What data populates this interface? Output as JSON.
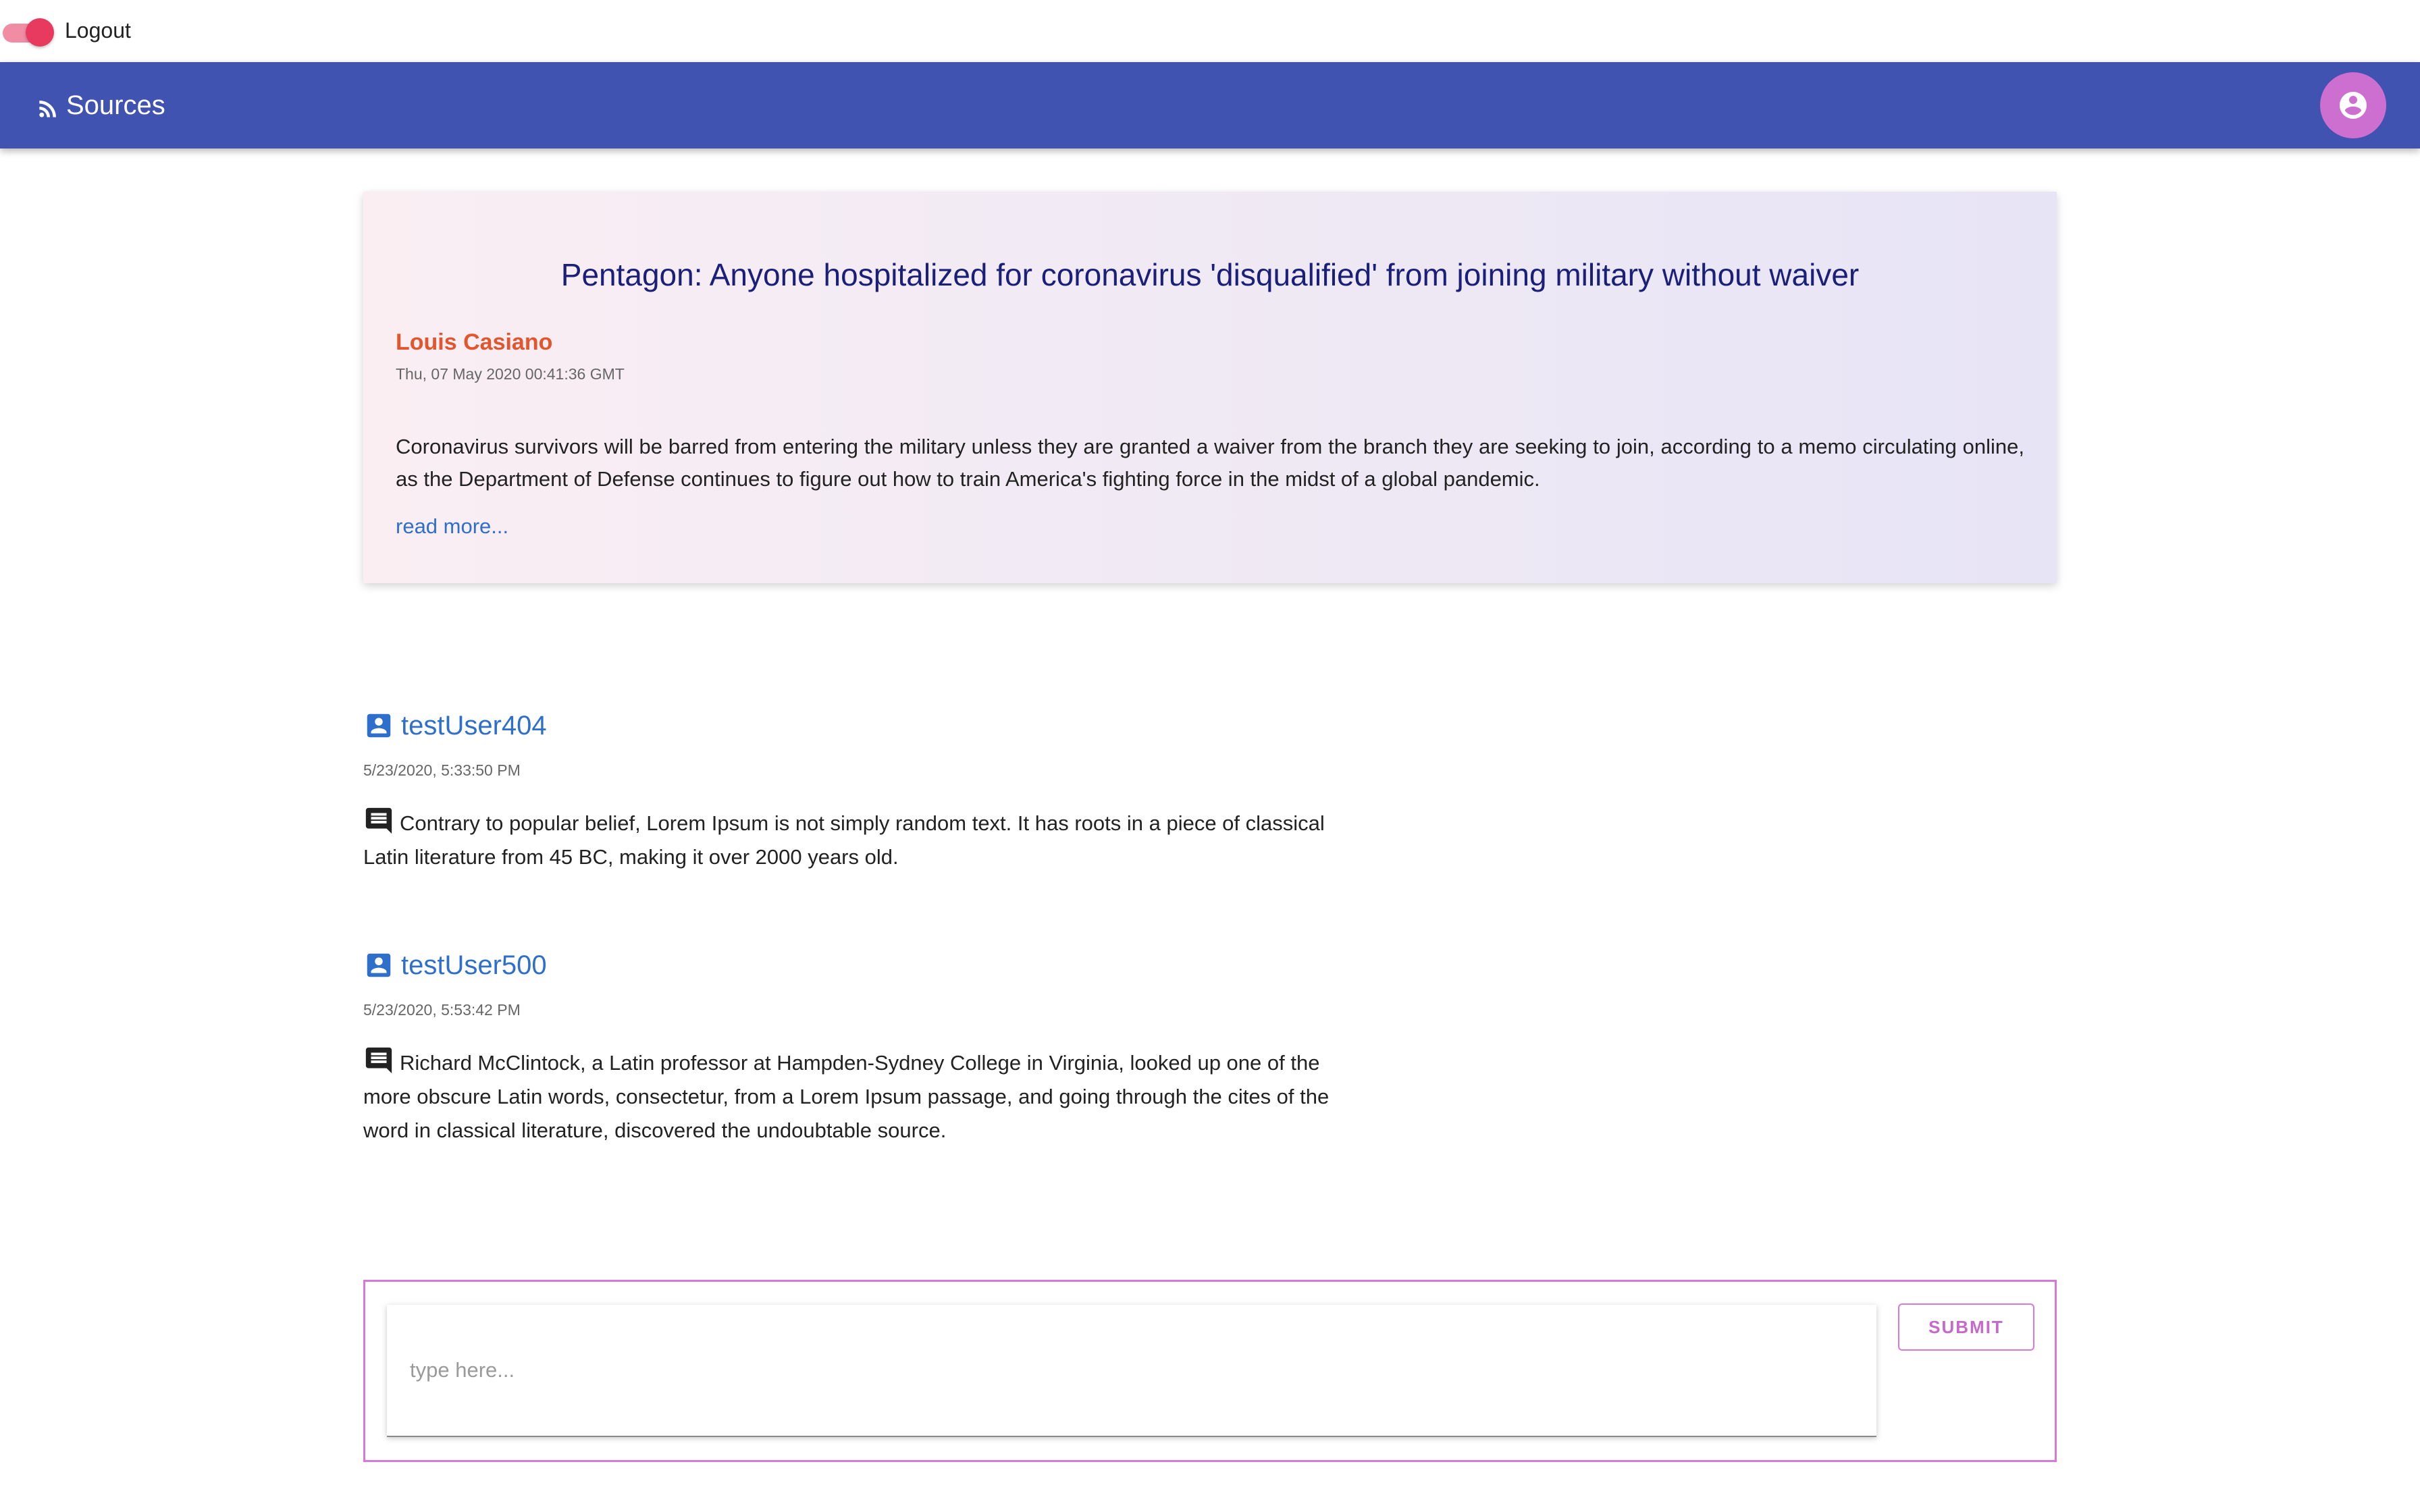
{
  "topbar": {
    "toggle_icon": "toggle-switch-icon",
    "logout_label": "Logout"
  },
  "appbar": {
    "brand_icon": "rss-feed-icon",
    "brand_label": "Sources",
    "avatar_icon": "account-circle-icon",
    "color": "#4153b1",
    "avatar_color": "#cd6fd0"
  },
  "article": {
    "title": "Pentagon: Anyone hospitalized for coronavirus 'disqualified' from joining military without waiver",
    "author": "Louis Casiano",
    "date": "Thu, 07 May 2020 00:41:36 GMT",
    "body": "Coronavirus survivors will be barred from entering the military unless they are granted a waiver from the branch they are seeking to join, according to a memo circulating online, as the Department of Defense continues to figure out how to train America's fighting force in the midst of a global pandemic.",
    "read_more": "read more..."
  },
  "comments": [
    {
      "user_icon": "account-box-icon",
      "username": "testUser404",
      "date": "5/23/2020, 5:33:50 PM",
      "comment_icon": "comment-icon",
      "text": "Contrary to popular belief, Lorem Ipsum is not simply random text. It has roots in a piece of classical Latin literature from 45 BC, making it over 2000 years old."
    },
    {
      "user_icon": "account-box-icon",
      "username": "testUser500",
      "date": "5/23/2020, 5:53:42 PM",
      "comment_icon": "comment-icon",
      "text": "Richard McClintock, a Latin professor at Hampden-Sydney College in Virginia, looked up one of the more obscure Latin words, consectetur, from a Lorem Ipsum passage, and going through the cites of the word in classical literature, discovered the undoubtable source."
    }
  ],
  "composer": {
    "placeholder": "type here...",
    "value": "",
    "submit_label": "SUBMIT",
    "accent": "#d57ad9"
  }
}
